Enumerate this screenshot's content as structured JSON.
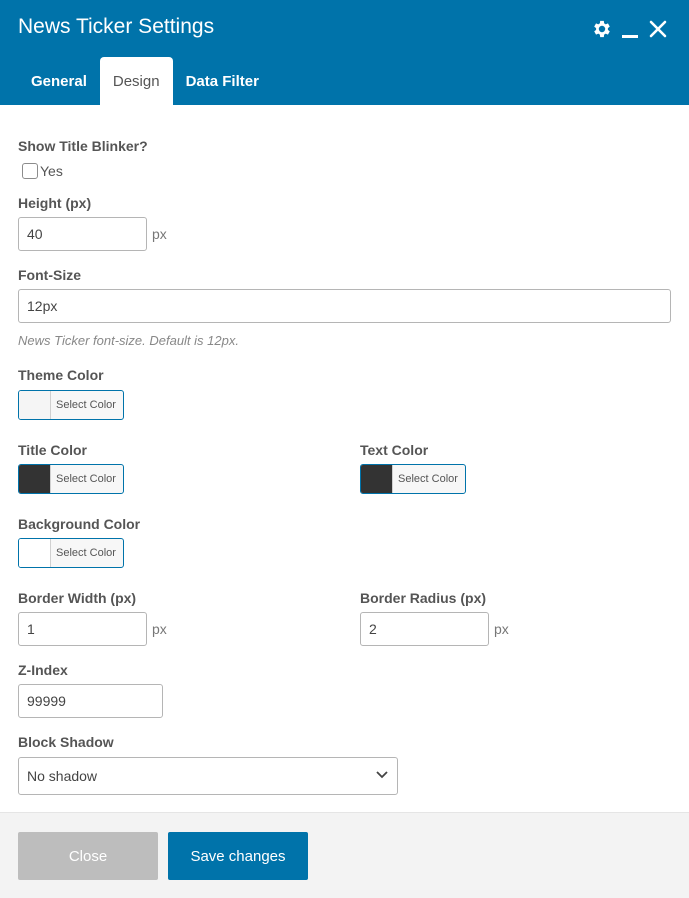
{
  "window": {
    "title": "News Ticker Settings"
  },
  "header_icons": [
    "gear-icon",
    "minimize-icon",
    "close-icon"
  ],
  "tabs": [
    {
      "label": "General",
      "active": false
    },
    {
      "label": "Design",
      "active": true
    },
    {
      "label": "Data Filter",
      "active": false
    }
  ],
  "form": {
    "title_blinker": {
      "label": "Show Title Blinker?",
      "option": "Yes",
      "checked": false
    },
    "height": {
      "label": "Height (px)",
      "value": "40",
      "unit": "px"
    },
    "font_size": {
      "label": "Font-Size",
      "value": "12px",
      "help": "News Ticker font-size. Default is 12px."
    },
    "theme_color": {
      "label": "Theme Color",
      "button": "Select Color",
      "swatch": "#f5f5f5"
    },
    "title_color": {
      "label": "Title Color",
      "button": "Select Color",
      "swatch": "#333333"
    },
    "text_color": {
      "label": "Text Color",
      "button": "Select Color",
      "swatch": "#333333"
    },
    "background_color": {
      "label": "Background Color",
      "button": "Select Color",
      "swatch": "#ffffff"
    },
    "border_width": {
      "label": "Border Width (px)",
      "value": "1",
      "unit": "px"
    },
    "border_radius": {
      "label": "Border Radius (px)",
      "value": "2",
      "unit": "px"
    },
    "z_index": {
      "label": "Z-Index",
      "value": "99999"
    },
    "block_shadow": {
      "label": "Block Shadow",
      "value": "No shadow"
    }
  },
  "footer": {
    "close_label": "Close",
    "save_label": "Save changes"
  },
  "colors": {
    "accent": "#0073aa",
    "disabled": "#bdbdbd"
  }
}
